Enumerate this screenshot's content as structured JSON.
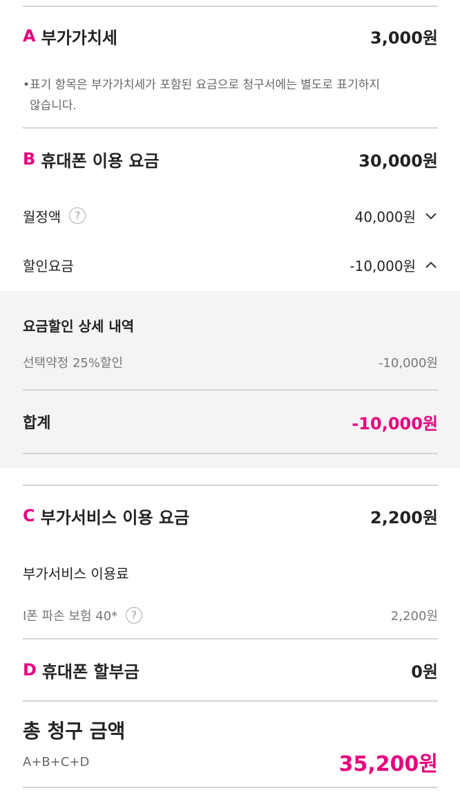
{
  "vat": {
    "letter": "A",
    "title": "부가가치세",
    "amount": "3,000원",
    "note_line1": "표기 항목은 부가가치세가 포함된 요금으로 청구서에는 별도로 표기하지",
    "note_line2": "않습니다.",
    "bullet": "•"
  },
  "phone_fee": {
    "letter": "B",
    "title": "휴대폰 이용 요금",
    "amount": "30,000원",
    "monthly_label": "월정액",
    "monthly_amount": "40,000원",
    "discount_label": "할인요금",
    "discount_amount": "-10,000원"
  },
  "discount_detail": {
    "title": "요금할인 상세 내역",
    "items": [
      {
        "label": "선택약정 25%할인",
        "amount": "-10,000원"
      }
    ],
    "sum_label": "합계",
    "sum_amount": "-10,000원"
  },
  "addon": {
    "letter": "C",
    "title": "부가서비스 이용 요금",
    "amount": "2,200원",
    "sub_title": "부가서비스 이용료",
    "items": [
      {
        "label": "I폰 파손 보험 40*",
        "amount": "2,200원"
      }
    ]
  },
  "installment": {
    "letter": "D",
    "title": "휴대폰 할부금",
    "amount": "0원"
  },
  "total": {
    "title": "총 청구 금액",
    "formula": "A+B+C+D",
    "amount": "35,200원"
  },
  "icons": {
    "help": "?"
  },
  "colors": {
    "accent": "#e6007e",
    "panel_bg": "#f4f4f4",
    "divider": "#d4d4d4"
  }
}
